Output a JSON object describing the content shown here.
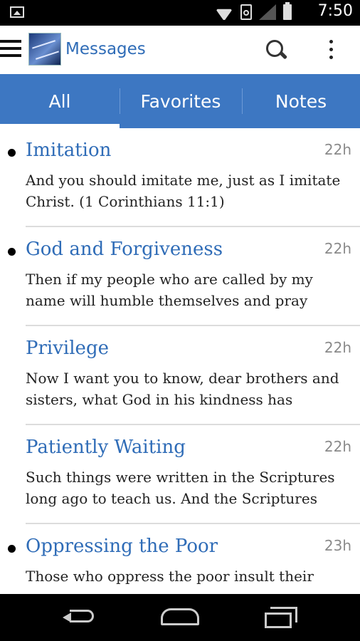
{
  "status_bar": {
    "time": "7:50",
    "icons": [
      "image-icon",
      "wifi-icon",
      "lock-icon",
      "signal-icon",
      "battery-icon"
    ]
  },
  "app_bar": {
    "title": "Messages",
    "icons": [
      "menu-icon",
      "app-logo",
      "search-icon",
      "more-vert-icon"
    ]
  },
  "tabs": [
    {
      "label": "All",
      "selected": true
    },
    {
      "label": "Favorites",
      "selected": false
    },
    {
      "label": "Notes",
      "selected": false
    }
  ],
  "messages": [
    {
      "title": "Imitation",
      "time": "22h",
      "unread": true,
      "body": "And you should imitate me, just as I imitate Christ. (1 Corinthians 11:1)"
    },
    {
      "title": "God and Forgiveness",
      "time": "22h",
      "unread": true,
      "body": "Then if my people who are called by my name will humble themselves and pray"
    },
    {
      "title": "Privilege",
      "time": "22h",
      "unread": false,
      "body": "Now I want you to know, dear brothers and sisters, what God in his kindness has"
    },
    {
      "title": "Patiently Waiting",
      "time": "22h",
      "unread": false,
      "body": "Such things were written in the Scriptures long ago to teach us. And the Scriptures"
    },
    {
      "title": "Oppressing the Poor",
      "time": "23h",
      "unread": true,
      "body": "Those who oppress the poor insult their"
    }
  ],
  "colors": {
    "accent": "#3d77c2",
    "title_text": "#2f6cb7",
    "status_bar": "#000000"
  },
  "nav_bar": {
    "icons": [
      "back-icon",
      "home-icon",
      "recents-icon"
    ]
  }
}
